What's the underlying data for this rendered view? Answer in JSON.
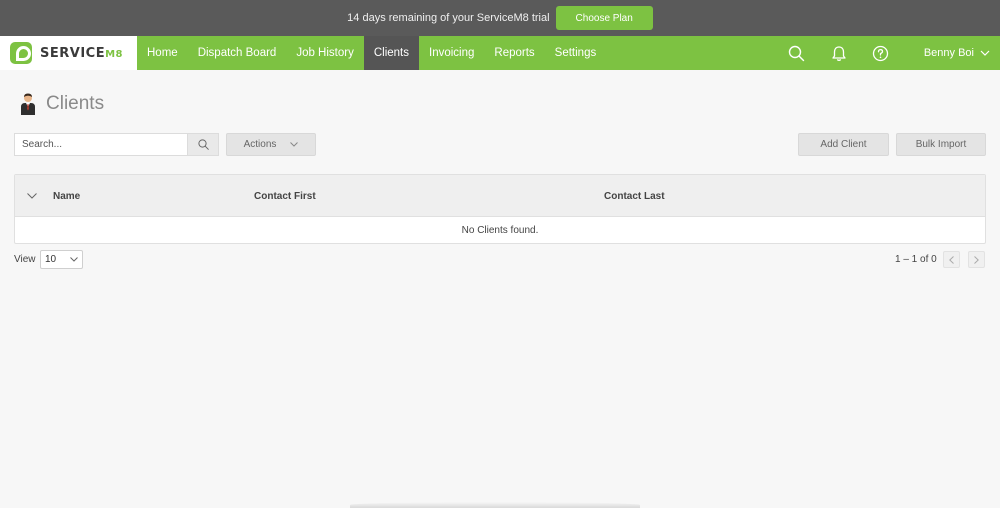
{
  "trial_banner": {
    "message": "14 days remaining of your ServiceM8 trial",
    "cta_label": "Choose Plan"
  },
  "brand": {
    "name": "SERVICE",
    "suffix": "M8",
    "accent_color": "#7dc242"
  },
  "nav": {
    "items": [
      {
        "label": "Home",
        "active": false
      },
      {
        "label": "Dispatch Board",
        "active": false
      },
      {
        "label": "Job History",
        "active": false
      },
      {
        "label": "Clients",
        "active": true
      },
      {
        "label": "Invoicing",
        "active": false
      },
      {
        "label": "Reports",
        "active": false
      },
      {
        "label": "Settings",
        "active": false
      }
    ],
    "icons": [
      "search-icon",
      "bell-icon",
      "help-icon"
    ],
    "user_name": "Benny Boi"
  },
  "page": {
    "title": "Clients",
    "icon": "person-icon"
  },
  "toolbar": {
    "search_placeholder": "Search...",
    "actions_label": "Actions",
    "add_client_label": "Add Client",
    "bulk_import_label": "Bulk Import"
  },
  "table": {
    "columns": [
      "Name",
      "Contact First",
      "Contact Last"
    ],
    "empty_message": "No Clients found."
  },
  "footer": {
    "view_label": "View",
    "page_size": "10",
    "pager_text": "1 – 1 of 0"
  }
}
